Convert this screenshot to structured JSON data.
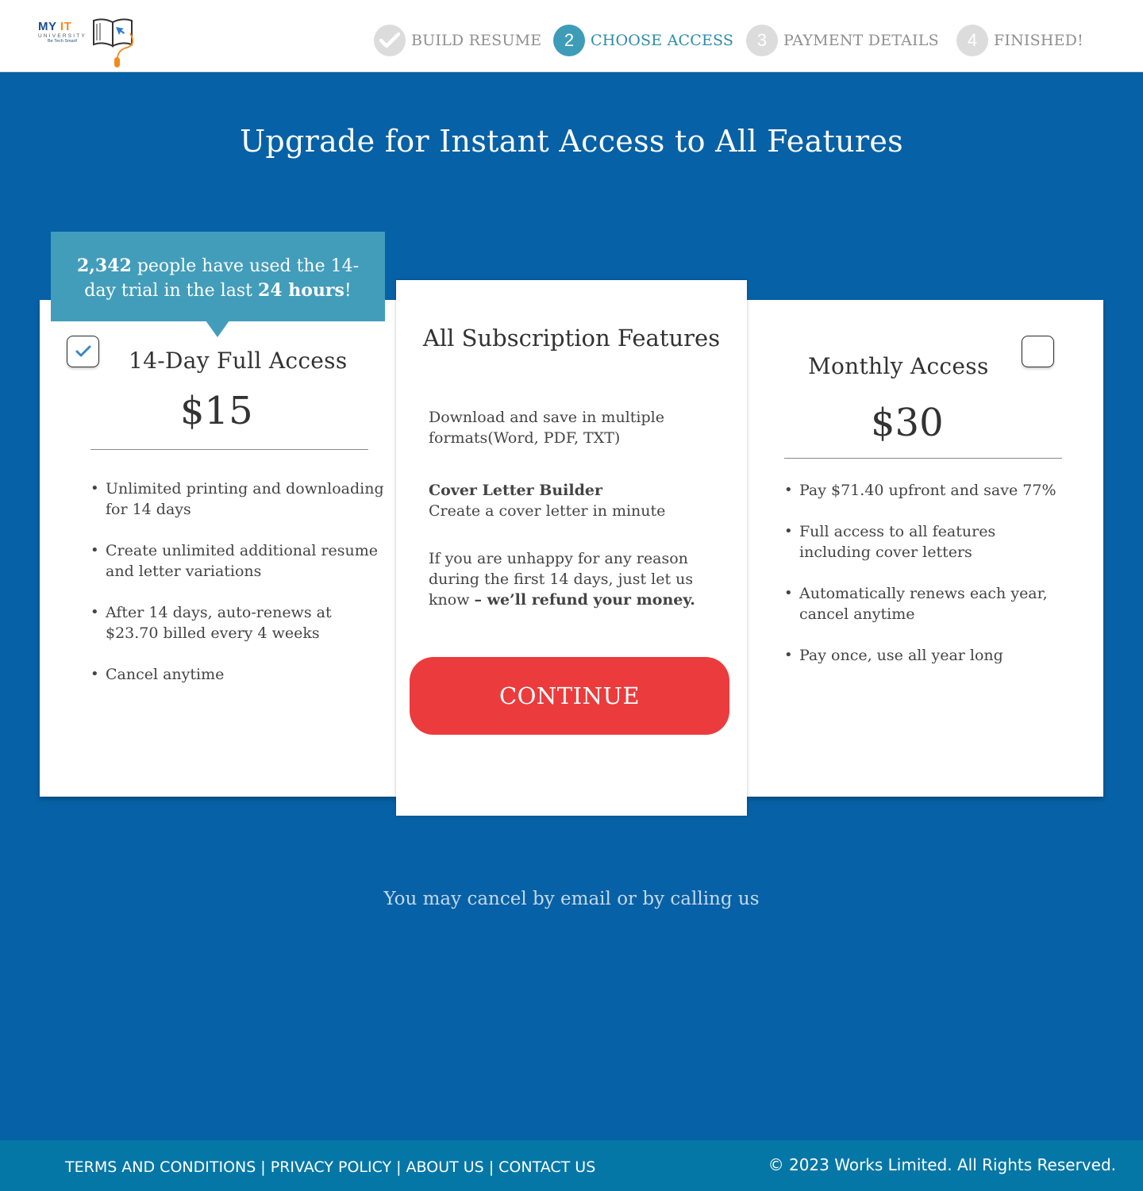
{
  "brand": {
    "name_part1": "MY",
    "name_part2": "IT",
    "subtitle": "UNIVERSITY",
    "tagline": "Be Tech Smart!"
  },
  "steps": [
    {
      "number": "✓",
      "label": "BUILD RESUME",
      "state": "completed"
    },
    {
      "number": "2",
      "label": "CHOOSE ACCESS",
      "state": "active"
    },
    {
      "number": "3",
      "label": "PAYMENT DETAILS",
      "state": "upcoming"
    },
    {
      "number": "4",
      "label": "FINISHED!",
      "state": "upcoming"
    }
  ],
  "page_title": "Upgrade for Instant Access to All Features",
  "banner": {
    "count": "2,342",
    "text_mid": " people have used the 14-day trial in the last ",
    "period": "24 hours",
    "text_end": "!"
  },
  "plans": {
    "trial": {
      "title": "14-Day Full Access",
      "price": "$15",
      "selected": true,
      "features": [
        "Unlimited printing and downloading for 14 days",
        "Create unlimited additional resume and letter variations",
        "After 14 days, auto-renews at $23.70 billed every 4 weeks",
        "Cancel anytime"
      ]
    },
    "monthly": {
      "title": "Monthly Access",
      "price": "$30",
      "selected": false,
      "features": [
        "Pay $71.40 upfront and save 77%",
        "Full access to all features including cover letters",
        "Automatically renews each year, cancel anytime",
        "Pay once, use all year long"
      ]
    }
  },
  "features_panel": {
    "title": "All Subscription Features",
    "download_text": "Download and save in multiple formats(Word, PDF, TXT)",
    "cover_letter_heading": "Cover Letter Builder",
    "cover_letter_text": "Create a cover letter in minute",
    "refund_text": "If you are unhappy for any reason during the first 14 days, just let us know ",
    "refund_bold": "– we’ll refund your money.",
    "continue_label": "CONTINUE"
  },
  "cancel_note": "You may cancel by email or by calling us",
  "footer": {
    "links": [
      "TERMS AND CONDITIONS",
      "PRIVACY POLICY",
      "ABOUT US",
      "CONTACT US"
    ],
    "separator": "|",
    "copyright": "© 2023 Works Limited. All Rights Reserved."
  },
  "colors": {
    "background": "#0761a6",
    "accent": "#429dba",
    "continue_button": "#ec3b3c",
    "footer": "#0577a6"
  }
}
